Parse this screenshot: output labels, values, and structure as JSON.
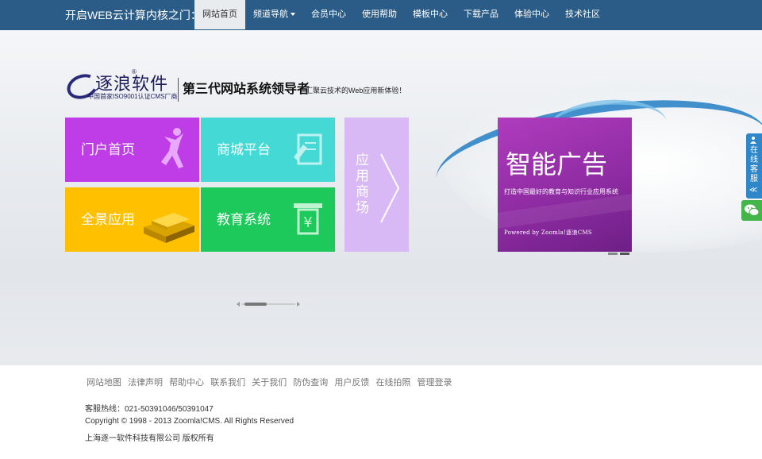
{
  "header": {
    "site_title": "开启WEB云计算内核之门：",
    "nav": [
      {
        "label": "网站首页",
        "active": true
      },
      {
        "label": "频道导航",
        "dropdown": true
      },
      {
        "label": "会员中心"
      },
      {
        "label": "使用帮助"
      },
      {
        "label": "模板中心"
      },
      {
        "label": "下载产品"
      },
      {
        "label": "体验中心"
      },
      {
        "label": "技术社区"
      }
    ]
  },
  "logo": {
    "name": "逐浪软件",
    "reg": "®",
    "sub": "中国首家ISO9001认证CMS厂商",
    "slogan": "第三代网站系统领导者",
    "slogan_sub": "汇聚云技术的Web应用新体验！"
  },
  "tiles": {
    "portal": "门户首页",
    "mall": "商城平台",
    "panorama": "全景应用",
    "education": "教育系统",
    "app_store": [
      "应",
      "用",
      "商",
      "场"
    ]
  },
  "ad": {
    "title": "智能广告",
    "subtitle": "打造中国最好的教育与知识行业应用系统",
    "powered": "Powered by Zoomla!逐浪CMS"
  },
  "service": {
    "chars": [
      "在",
      "线",
      "客",
      "服"
    ],
    "arrow": "≪"
  },
  "footer": {
    "links": [
      "网站地图",
      "法律声明",
      "帮助中心",
      "联系我们",
      "关于我们",
      "防伪查询",
      "用户反馈",
      "在线拍照",
      "管理登录"
    ],
    "hotline": "客服热线：021-50391046/50391047",
    "copyright": "Copyright © 1998 - 2013 Zoomla!CMS. All Rights Reserved",
    "company": "上海逐一软件科技有限公司 版权所有"
  },
  "colors": {
    "nav_bg": "#2a5c87",
    "portal": "#bf3de6",
    "mall": "#44d9d4",
    "panorama": "#ffc000",
    "education": "#1ec95c",
    "app_store": "#d8b8f5",
    "ad": "#9a32ad"
  }
}
